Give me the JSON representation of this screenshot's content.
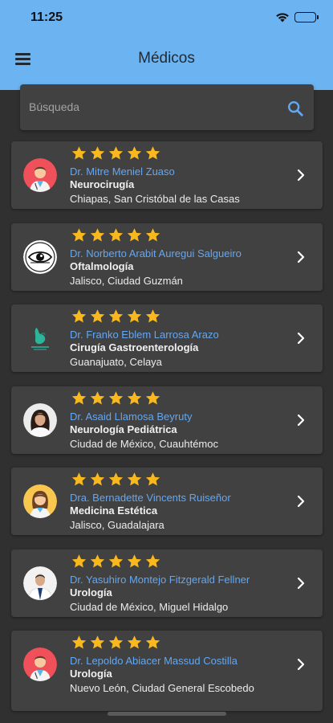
{
  "status_bar": {
    "time": "11:25"
  },
  "header": {
    "title": "Médicos"
  },
  "search": {
    "placeholder": "Búsqueda"
  },
  "colors": {
    "header": "#6cb3f1",
    "background": "#303030",
    "card": "#414141",
    "accent": "#63a7f1",
    "star": "#f9b81e"
  },
  "doctors": [
    {
      "name": "Dr. Mitre Meniel Zuaso",
      "specialty": "Neurocirugía",
      "location": "Chiapas,  San Cristóbal de las Casas",
      "rating": 5,
      "avatar": "doctor-male-avatar"
    },
    {
      "name": "Dr. Norberto Arabit Auregui Salgueiro",
      "specialty": "Oftalmología",
      "location": "Jalisco,  Ciudad Guzmán",
      "rating": 5,
      "avatar": "eye-logo"
    },
    {
      "name": "Dr. Franko Eblem Larrosa Arazo",
      "specialty": "Cirugía Gastroenterología",
      "location": "Guanajuato,  Celaya",
      "rating": 5,
      "avatar": "gastro-logo"
    },
    {
      "name": "Dr. Asaid Llamosa Beyruty",
      "specialty": "Neurología Pediátrica",
      "location": "Ciudad de México,  Cuauhtémoc",
      "rating": 5,
      "avatar": "doctor-female-photo"
    },
    {
      "name": "Dra. Bernadette Vincents Ruiseñor",
      "specialty": "Medicina Estética",
      "location": "Jalisco,  Guadalajara",
      "rating": 5,
      "avatar": "doctor-female-avatar"
    },
    {
      "name": "Dr. Yasuhiro Montejo Fitzgerald Fellner",
      "specialty": "Urología",
      "location": "Ciudad de México,  Miguel Hidalgo",
      "rating": 5,
      "avatar": "doctor-male-photo"
    },
    {
      "name": "Dr. Lepoldo Abiacer Massud Costilla",
      "specialty": "Urología",
      "location": "Nuevo León,  Ciudad General Escobedo",
      "rating": 5,
      "avatar": "doctor-male-avatar"
    }
  ]
}
